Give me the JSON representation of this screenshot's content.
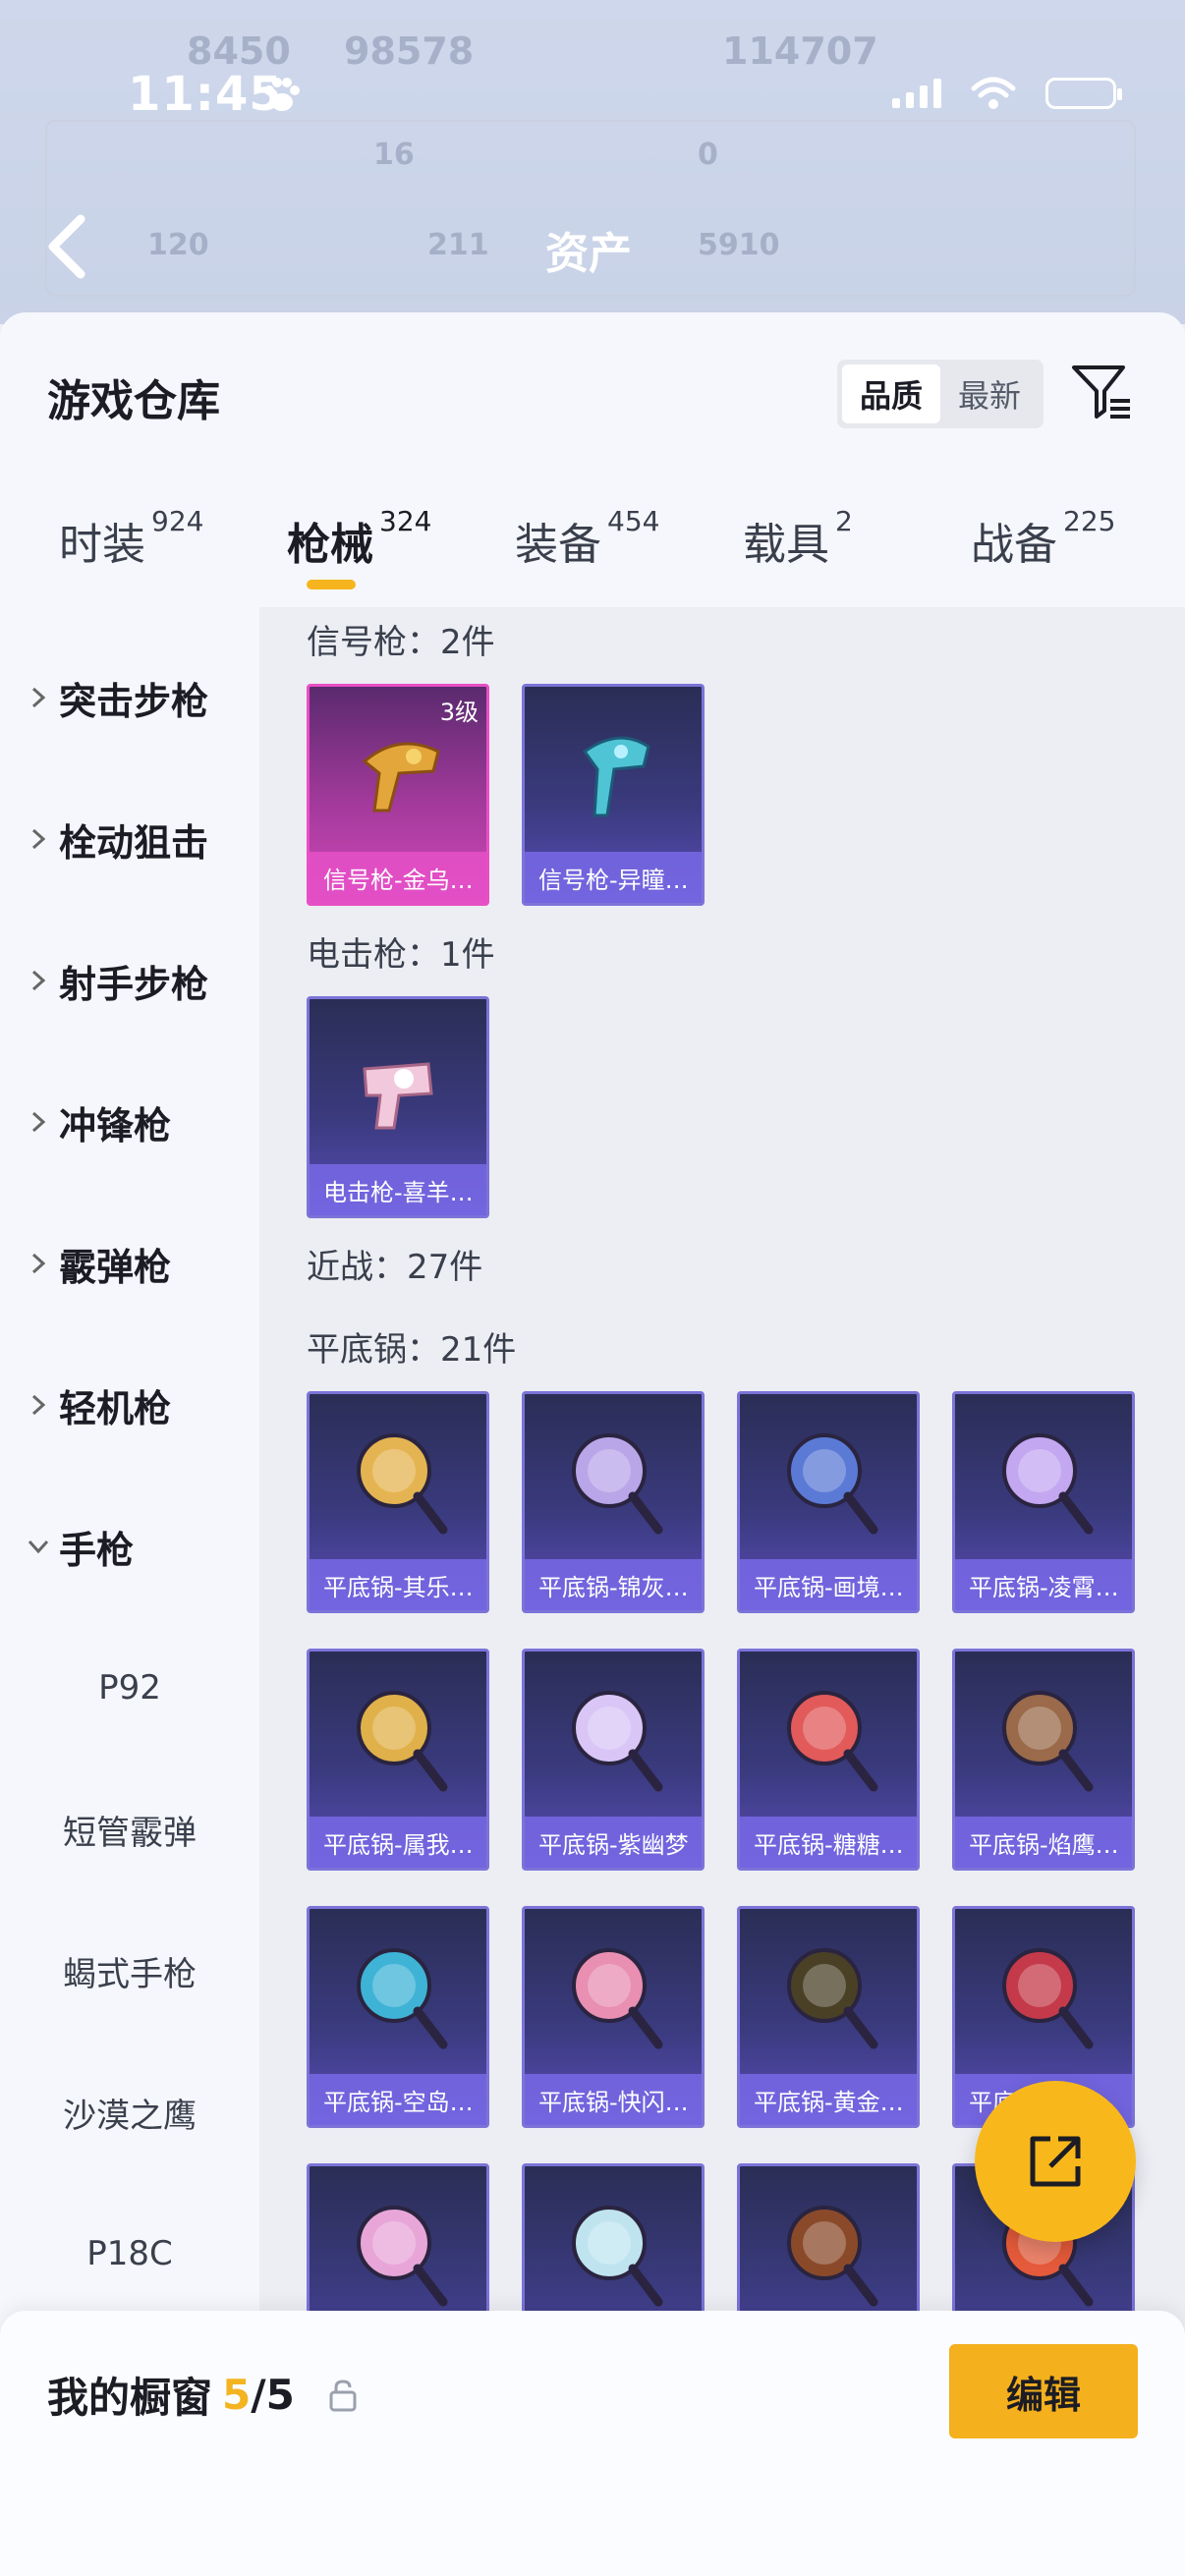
{
  "status_bar": {
    "time": "11:45"
  },
  "background": {
    "title": "资产",
    "ghost_numbers": [
      "8450",
      "98578",
      "114707",
      "120",
      "211",
      "5910",
      "16",
      "0"
    ]
  },
  "sheet": {
    "title": "游戏仓库",
    "sort_options": [
      "品质",
      "最新"
    ],
    "sort_selected": "品质"
  },
  "tabs": [
    {
      "label": "时装",
      "count": "924"
    },
    {
      "label": "枪械",
      "count": "324"
    },
    {
      "label": "装备",
      "count": "454"
    },
    {
      "label": "载具",
      "count": "2"
    },
    {
      "label": "战备",
      "count": "225"
    }
  ],
  "active_tab": "枪械",
  "sidebar": {
    "categories": [
      "突击步枪",
      "栓动狙击",
      "射手步枪",
      "冲锋枪",
      "霰弹枪",
      "轻机枪",
      "手枪"
    ],
    "expanded": "手枪",
    "subitems": [
      "P92",
      "短管霰弹",
      "蝎式手枪",
      "沙漠之鹰",
      "P18C"
    ]
  },
  "groups": {
    "flare": {
      "label": "信号枪：2件",
      "items": [
        {
          "name": "信号枪-金乌…",
          "level": "3级"
        },
        {
          "name": "信号枪-异瞳…"
        }
      ]
    },
    "stun": {
      "label": "电击枪：1件",
      "items": [
        {
          "name": "电击枪-喜羊…"
        }
      ]
    },
    "melee": {
      "label": "近战：27件"
    },
    "pan": {
      "label": "平底锅：21件",
      "items": [
        {
          "name": "平底锅-其乐…"
        },
        {
          "name": "平底锅-锦灰…"
        },
        {
          "name": "平底锅-画境…"
        },
        {
          "name": "平底锅-凌霄…"
        },
        {
          "name": "平底锅-属我…"
        },
        {
          "name": "平底锅-紫幽梦"
        },
        {
          "name": "平底锅-糖糖…"
        },
        {
          "name": "平底锅-焰鹰…"
        },
        {
          "name": "平底锅-空岛…"
        },
        {
          "name": "平底锅-快闪…"
        },
        {
          "name": "平底锅-黄金…"
        },
        {
          "name": "平底…"
        },
        {
          "name": ""
        },
        {
          "name": ""
        },
        {
          "name": ""
        },
        {
          "name": ""
        }
      ]
    }
  },
  "bottom_bar": {
    "label": "我的橱窗",
    "current": "5",
    "total": "/5",
    "edit_label": "编辑"
  },
  "colors": {
    "accent": "#f4b01d",
    "card_purple": "#5a4eb8",
    "card_gold": "#cf49b7"
  }
}
